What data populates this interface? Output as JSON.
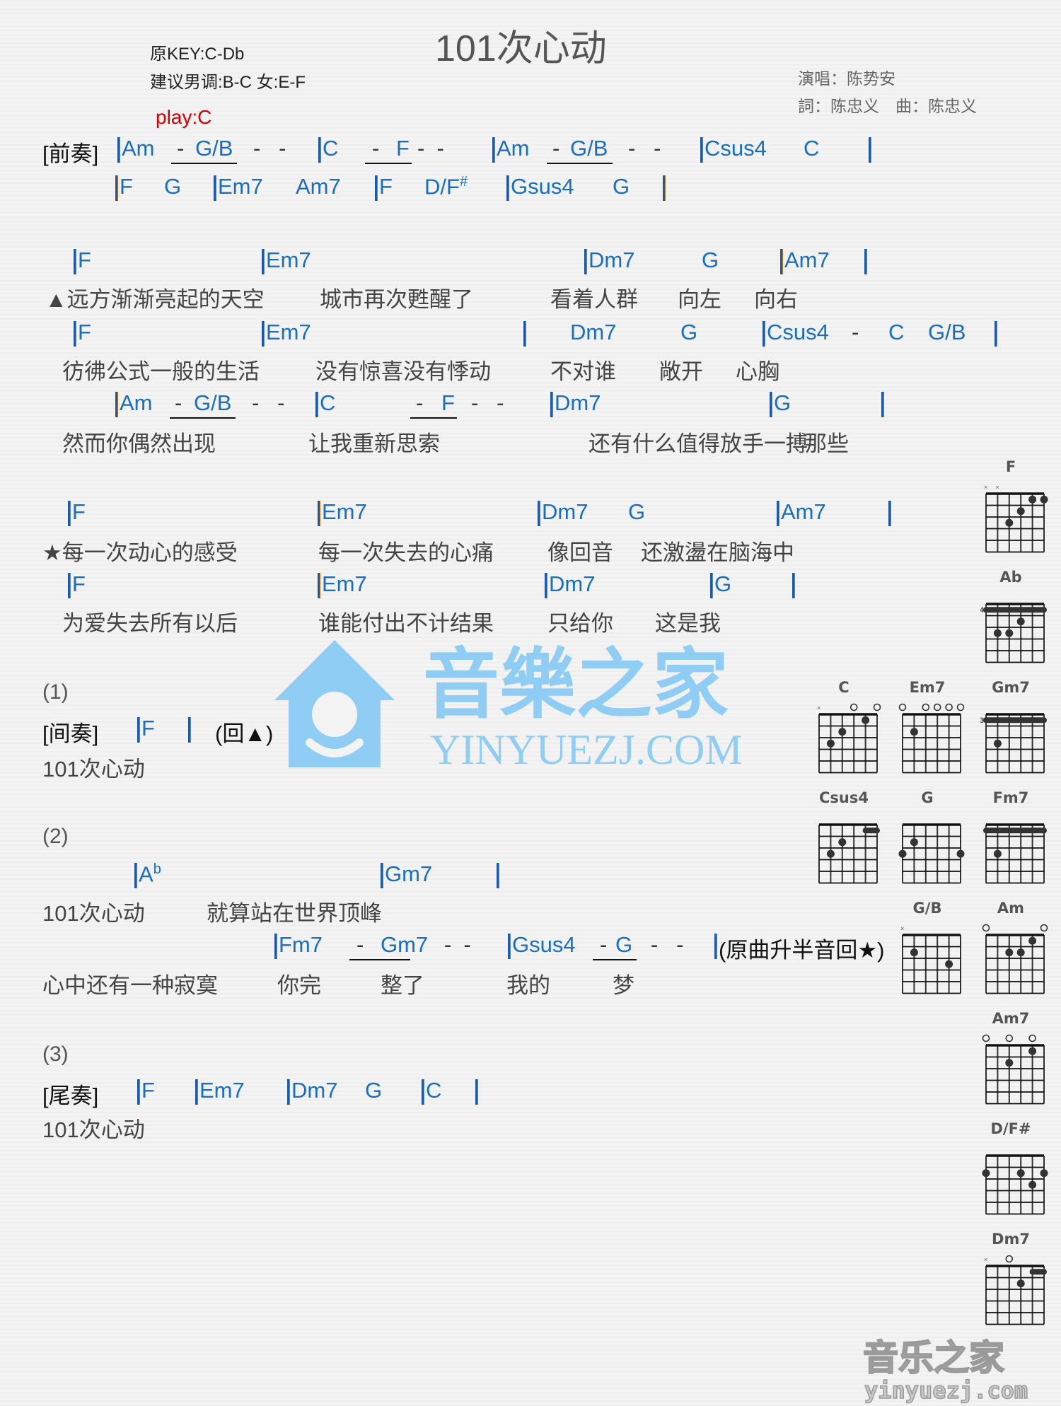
{
  "title": "101次心动",
  "meta": {
    "original_key": "原KEY:C-Db",
    "suggested_key": "建议男调:B-C 女:E-F",
    "play_key": "play:C",
    "singer": "演唱：陈势安",
    "credits": "詞：陈忠义　曲：陈忠义"
  },
  "intro": {
    "label": "[前奏]",
    "row1": [
      "Am",
      "G/B",
      "C",
      "F",
      "Am",
      "G/B",
      "Csus4",
      "C"
    ],
    "row2": [
      "F",
      "G",
      "Em7",
      "Am7",
      "F",
      "D/F",
      "#",
      "Gsus4",
      "G"
    ]
  },
  "verse": {
    "chords1": [
      "F",
      "Em7",
      "Dm7",
      "G",
      "Am7"
    ],
    "lyrics1": [
      "▲远方渐渐亮起的天空",
      "城市再次甦醒了",
      "看着人群",
      "向左",
      "向右"
    ],
    "chords2": [
      "F",
      "Em7",
      "Dm7",
      "G",
      "Csus4",
      "C",
      "G/B"
    ],
    "lyrics2": [
      "彷彿公式一般的生活",
      "没有惊喜没有悸动",
      "不对谁",
      "敞开",
      "心胸"
    ],
    "chords3": [
      "Am",
      "G/B",
      "C",
      "F",
      "Dm7",
      "G"
    ],
    "lyrics3": [
      "然而你偶然出现",
      "让我重新思索",
      "还有什么值得放手一搏",
      "那些"
    ]
  },
  "chorus": {
    "chords1": [
      "F",
      "Em7",
      "Dm7",
      "G",
      "Am7"
    ],
    "lyrics1": [
      "★每一次动心的感受",
      "每一次失去的心痛",
      "像回音",
      "还激盪在脑海中"
    ],
    "chords2": [
      "F",
      "Em7",
      "Dm7",
      "G"
    ],
    "lyrics2": [
      "为爱失去所有以后",
      "谁能付出不计结果",
      "只给你",
      "这是我"
    ]
  },
  "part1": {
    "number": "(1)",
    "label": "[间奏]",
    "chord": "F",
    "repeat": "(回▲)",
    "lyric": "101次心动"
  },
  "part2": {
    "number": "(2)",
    "chords1": [
      "A",
      "b",
      "Gm7"
    ],
    "lyrics1": [
      "101次心动",
      "就算站在世界顶峰"
    ],
    "chords2": [
      "Fm7",
      "Gm7",
      "Gsus4",
      "G"
    ],
    "note": "(原曲升半音回★)",
    "lyrics2": [
      "心中还有一种寂寞",
      "你完",
      "整了",
      "我的",
      "梦"
    ]
  },
  "part3": {
    "number": "(3)",
    "label": "[尾奏]",
    "chords": [
      "F",
      "Em7",
      "Dm7",
      "G",
      "C"
    ],
    "lyric": "101次心动"
  },
  "diagrams": [
    {
      "name": "F",
      "fret": "",
      "marks": "xx....",
      "dots": [
        [
          4,
          1
        ],
        [
          5,
          1
        ],
        [
          3,
          2
        ],
        [
          2,
          3
        ]
      ],
      "barre": null
    },
    {
      "name": "Ab",
      "fret": "4",
      "marks": "......",
      "dots": [
        [
          3,
          2
        ],
        [
          1,
          3
        ],
        [
          2,
          3
        ]
      ],
      "barre": [
        0,
        5,
        1
      ]
    },
    {
      "name": "C",
      "fret": "",
      "marks": "x..o.o",
      "dots": [
        [
          4,
          1
        ],
        [
          2,
          2
        ],
        [
          1,
          3
        ]
      ],
      "barre": null
    },
    {
      "name": "Em7",
      "fret": "",
      "marks": "o.oooo",
      "dots": [
        [
          1,
          2
        ]
      ],
      "barre": null
    },
    {
      "name": "Gm7",
      "fret": "3",
      "marks": "......",
      "dots": [
        [
          1,
          3
        ]
      ],
      "barre": [
        0,
        5,
        1
      ]
    },
    {
      "name": "Csus4",
      "fret": "",
      "marks": "......",
      "dots": [
        [
          2,
          2
        ],
        [
          1,
          3
        ]
      ],
      "barre": [
        4,
        5,
        1
      ]
    },
    {
      "name": "G",
      "fret": "",
      "marks": "......",
      "dots": [
        [
          1,
          2
        ],
        [
          0,
          3
        ],
        [
          5,
          3
        ]
      ],
      "barre": null
    },
    {
      "name": "Fm7",
      "fret": "",
      "marks": "......",
      "dots": [
        [
          1,
          3
        ]
      ],
      "barre": [
        0,
        5,
        1
      ]
    },
    {
      "name": "G/B",
      "fret": "",
      "marks": "x.....",
      "dots": [
        [
          1,
          2
        ],
        [
          4,
          3
        ]
      ],
      "barre": null
    },
    {
      "name": "Am",
      "fret": "",
      "marks": "o....o",
      "dots": [
        [
          4,
          1
        ],
        [
          2,
          2
        ],
        [
          3,
          2
        ]
      ],
      "barre": null
    },
    {
      "name": "Am7",
      "fret": "",
      "marks": "o.o.o.",
      "dots": [
        [
          4,
          1
        ],
        [
          2,
          2
        ]
      ],
      "barre": null
    },
    {
      "name": "D/F#",
      "fret": "",
      "marks": "......",
      "dots": [
        [
          0,
          2
        ],
        [
          3,
          2
        ],
        [
          5,
          2
        ],
        [
          4,
          3
        ]
      ],
      "barre": null
    },
    {
      "name": "Dm7",
      "fret": "",
      "marks": "x.o...",
      "dots": [
        [
          3,
          2
        ]
      ],
      "barre": [
        4,
        5,
        1
      ]
    }
  ],
  "watermark": {
    "brand": "音樂之家",
    "url": "YINYUEZJ.COM",
    "brand_small": "音乐之家",
    "url_small": "yinyuezj.com"
  }
}
